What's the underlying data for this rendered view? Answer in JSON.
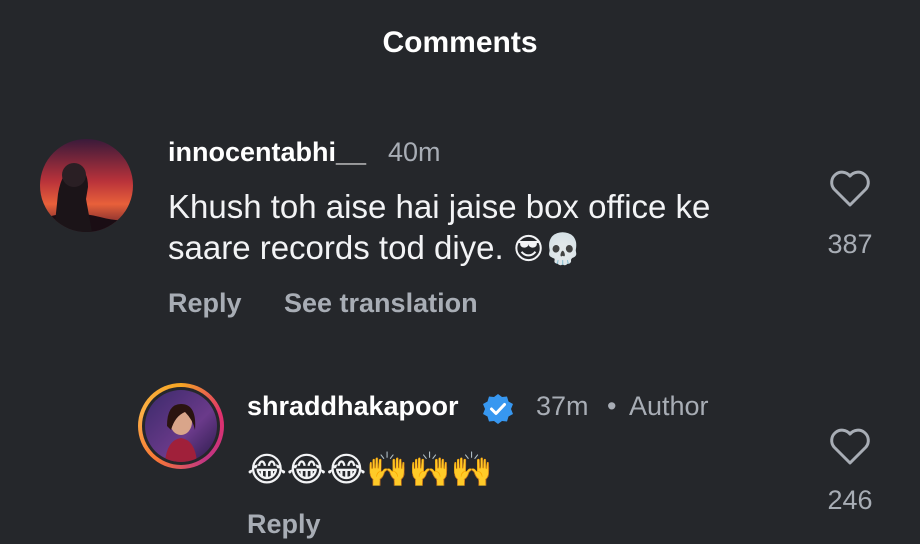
{
  "header": {
    "title": "Comments"
  },
  "comments": [
    {
      "username": "innocentabhi__",
      "time": "40m",
      "text_line1": "Khush toh aise hai jaise box office ke",
      "text_line2": "saare records tod diye.",
      "emojis": "😎💀",
      "likes": "387",
      "reply_label": "Reply",
      "translate_label": "See translation"
    },
    {
      "username": "shraddhakapoor",
      "verified": true,
      "time": "37m",
      "separator": "•",
      "author_label": "Author",
      "emojis": "😂😂😂🙌🙌🙌",
      "likes": "246",
      "reply_label": "Reply"
    }
  ],
  "colors": {
    "background": "#25272b",
    "muted_text": "#a8adb5",
    "verified_blue": "#3797f0"
  }
}
